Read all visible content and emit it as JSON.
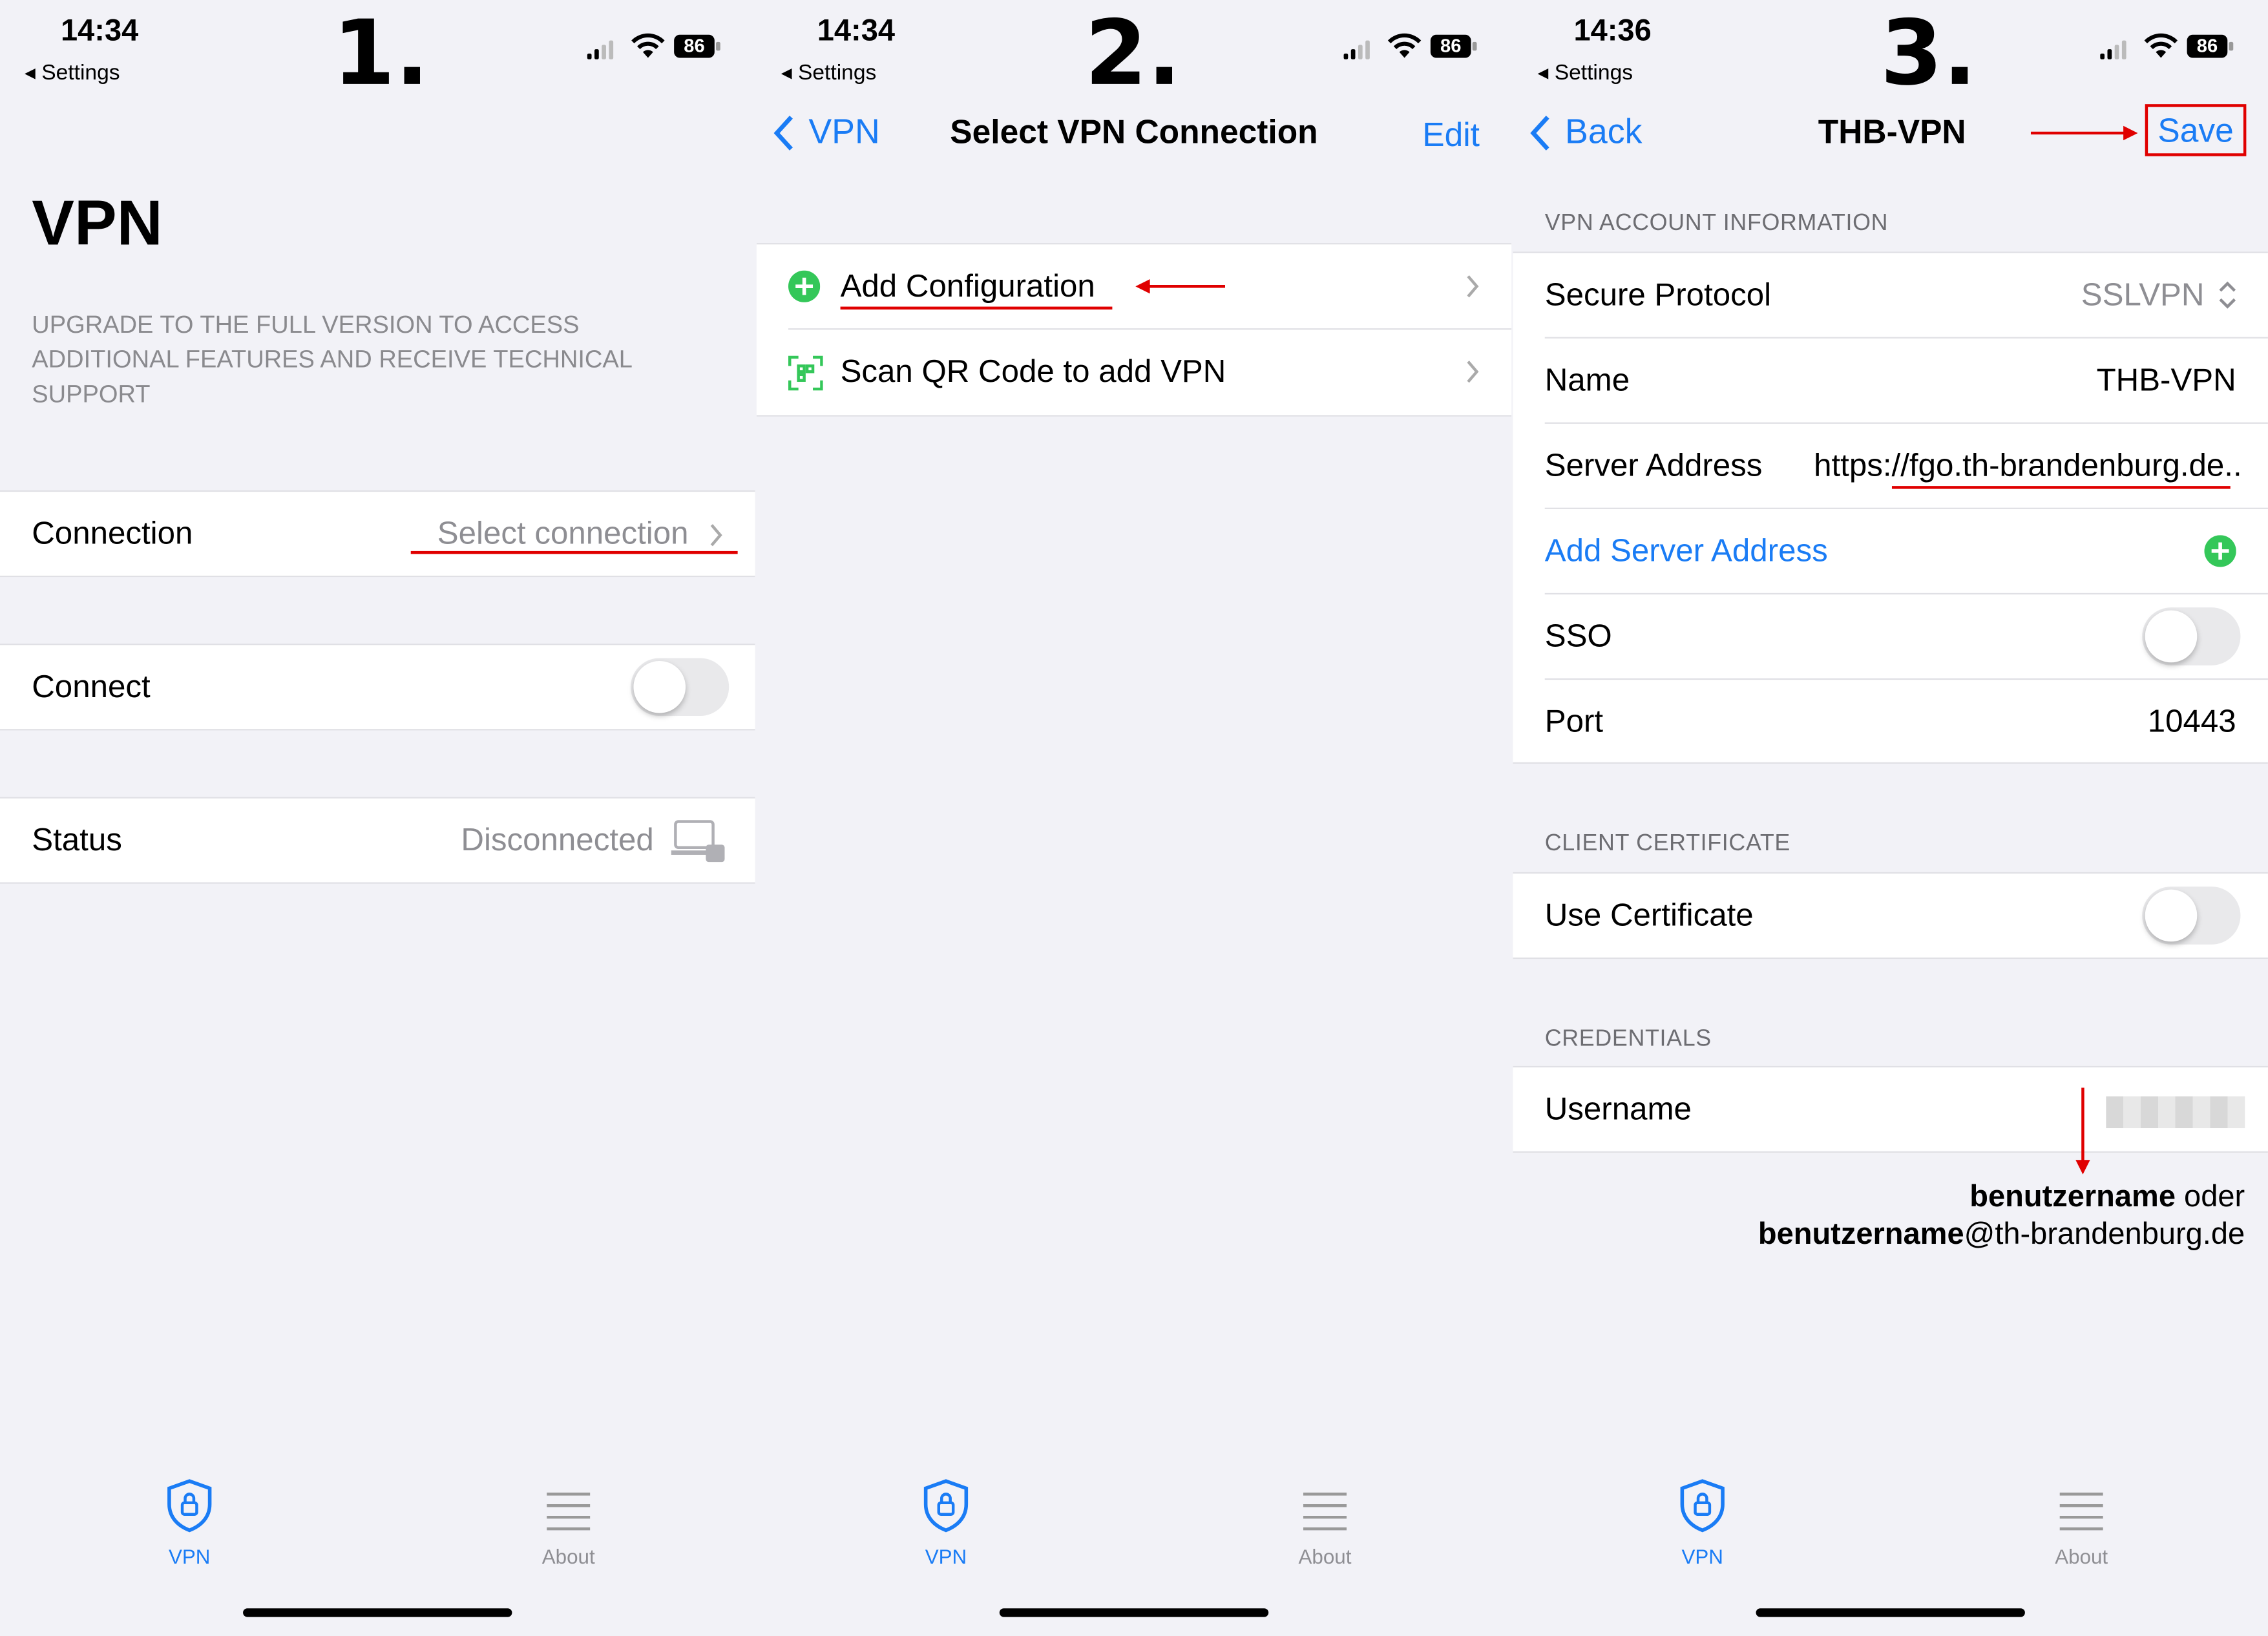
{
  "status": {
    "battery": "86",
    "back_label": "◂ Settings"
  },
  "panel1": {
    "time": "14:34",
    "step": "1.",
    "title": "VPN",
    "upgrade_text": "UPGRADE TO THE FULL VERSION TO ACCESS ADDITIONAL FEATURES AND RECEIVE TECHNICAL SUPPORT",
    "connection_label": "Connection",
    "connection_value": "Select connection",
    "connect_label": "Connect",
    "status_label": "Status",
    "status_value": "Disconnected"
  },
  "panel2": {
    "time": "14:34",
    "step": "2.",
    "back_label": "VPN",
    "title": "Select VPN Connection",
    "edit_label": "Edit",
    "add_config": "Add Configuration",
    "scan_qr": "Scan QR Code to add VPN"
  },
  "panel3": {
    "time": "14:36",
    "step": "3.",
    "back_label": "Back",
    "title": "THB-VPN",
    "save_label": "Save",
    "account_header": "VPN ACCOUNT INFORMATION",
    "protocol_label": "Secure Protocol",
    "protocol_value": "SSLVPN",
    "name_label": "Name",
    "name_value": "THB-VPN",
    "server_label": "Server Address",
    "server_value": "https://fgo.th-brandenburg.de..",
    "add_server": "Add Server Address",
    "sso_label": "SSO",
    "port_label": "Port",
    "port_value": "10443",
    "cert_header": "CLIENT CERTIFICATE",
    "use_cert_label": "Use Certificate",
    "cred_header": "CREDENTIALS",
    "username_label": "Username",
    "note_bold1": "benutzername",
    "note_rest1": " oder",
    "note_bold2": "benutzername",
    "note_rest2": "@th-brandenburg.de"
  },
  "tabs": {
    "vpn": "VPN",
    "about": "About"
  },
  "colors": {
    "accent": "#1a7cf5",
    "annotation": "#e00000",
    "add_green": "#34c759",
    "background": "#f2f2f7"
  }
}
